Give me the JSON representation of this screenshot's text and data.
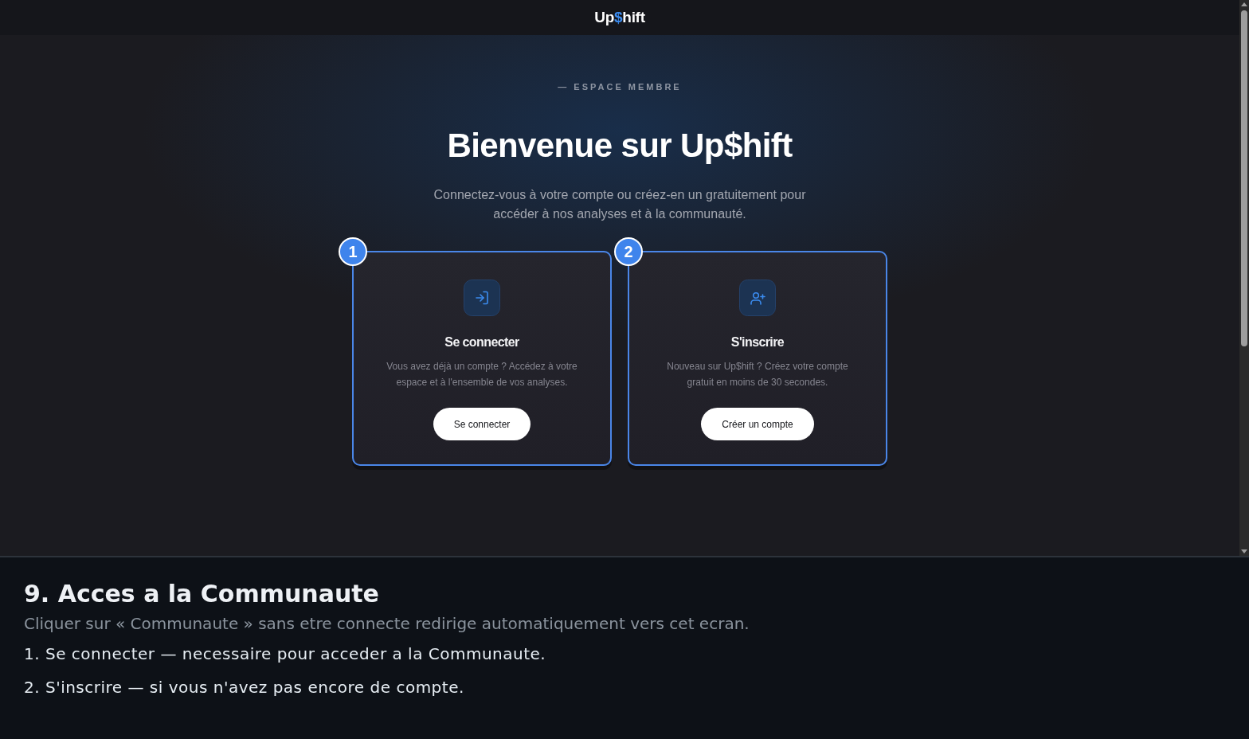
{
  "page": {
    "header": {
      "logo": [
        {
          "text": "Up",
          "accent": false
        },
        {
          "text": "$",
          "accent": true
        },
        {
          "text": "hift",
          "accent": false
        }
      ]
    },
    "hero": {
      "eyebrow": "— ESPACE MEMBRE",
      "title": "Bienvenue sur Up$hift",
      "subtitle": "Connectez-vous à votre compte ou créez-en un gratuitement pour accéder à nos analyses et à la communauté."
    },
    "cards": [
      {
        "kind": "login",
        "badge": "1",
        "highlighted": true,
        "title": "Se connecter",
        "description": "Vous avez déjà un compte ? Accédez à votre espace et à l'ensemble de vos analyses.",
        "button": "Se connecter"
      },
      {
        "kind": "register",
        "badge": "2",
        "highlighted": true,
        "title": "S'inscrire",
        "description": "Nouveau sur Up$hift ? Créez votre compte gratuit en moins de 30 secondes.",
        "button": "Créer un compte"
      }
    ]
  },
  "caption": {
    "title": "9. Acces a la Communaute",
    "subtitle": "Cliquer sur « Communaute » sans etre connecte redirige automatiquement vers cet ecran.",
    "steps": [
      "1. Se connecter — necessaire pour acceder a la Communaute.",
      "2. S'inscrire — si vous n'avez pas encore de compte."
    ]
  }
}
